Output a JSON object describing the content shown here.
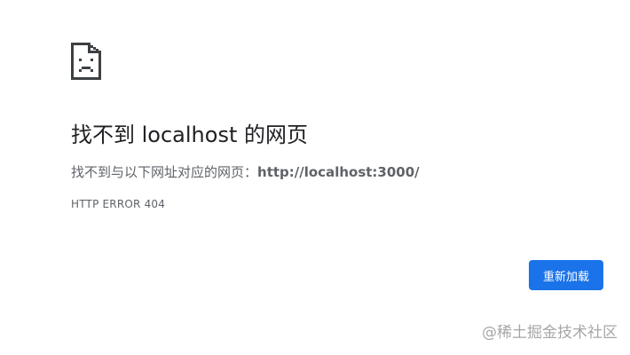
{
  "page": {
    "title": "找不到 localhost 的网页",
    "message_prefix": "找不到与以下网址对应的网页：",
    "url": "http://localhost:3000/",
    "error_code": "HTTP ERROR 404",
    "icon": "sad-document-icon"
  },
  "actions": {
    "reload_label": "重新加载"
  },
  "watermark": {
    "text": "@稀土掘金技术社区"
  },
  "colors": {
    "accent": "#1a73e8",
    "title_text": "#202124",
    "body_text": "#5f6368"
  }
}
